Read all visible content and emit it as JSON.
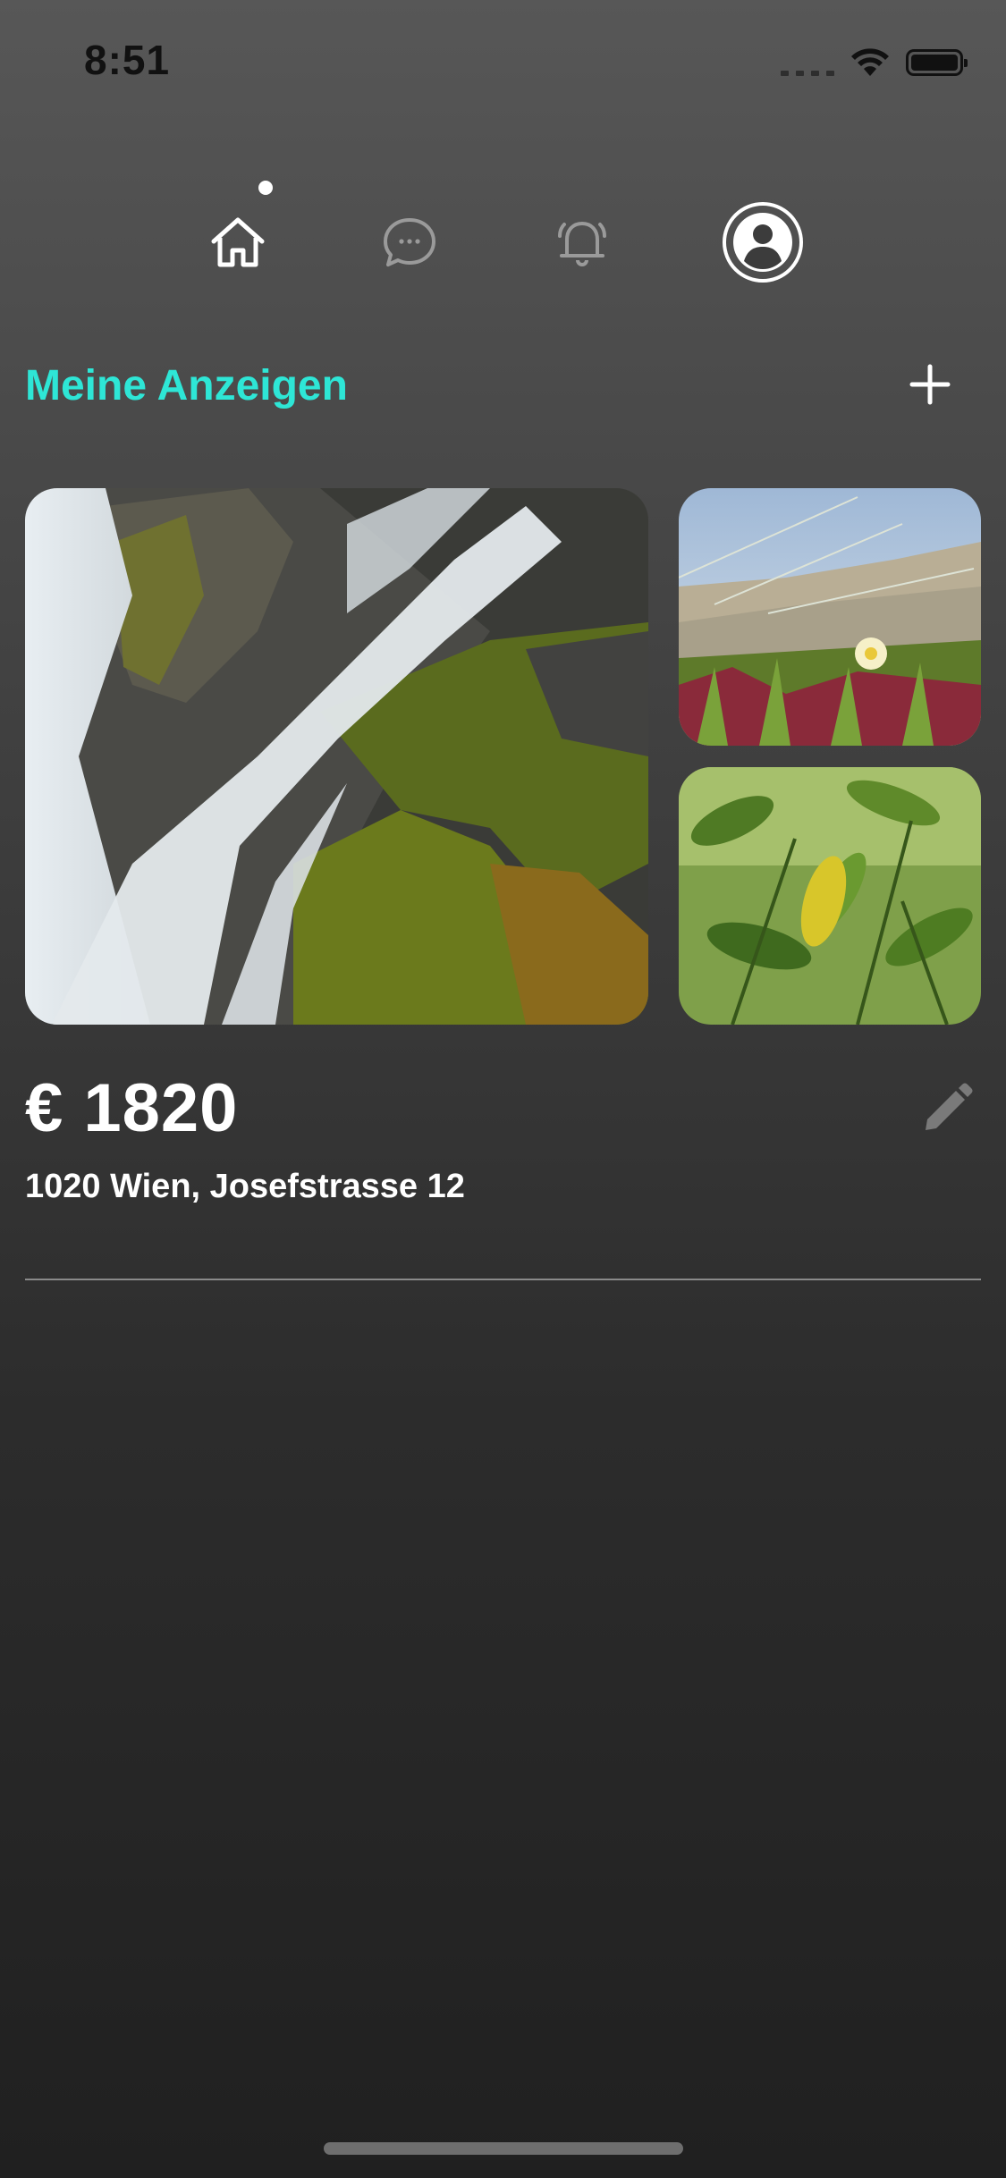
{
  "status_bar": {
    "time": "8:51",
    "icons": [
      "cellular-signal-icon",
      "wifi-icon",
      "battery-icon"
    ]
  },
  "nav": {
    "tabs": [
      {
        "icon": "home-icon",
        "active": true,
        "has_indicator": true
      },
      {
        "icon": "chat-icon",
        "active": false
      },
      {
        "icon": "bell-icon",
        "active": false
      },
      {
        "icon": "profile-icon",
        "active": true
      }
    ]
  },
  "section": {
    "title": "Meine Anzeigen",
    "add_icon": "plus-icon"
  },
  "listing": {
    "price": "€ 1820",
    "address": "1020 Wien, Josefstrasse 12",
    "edit_icon": "pencil-icon",
    "photos": [
      {
        "subject": "waterfall over mossy rocks"
      },
      {
        "subject": "dune grass with yellow flower"
      },
      {
        "subject": "green leaves with yellow leaf"
      }
    ]
  },
  "colors": {
    "accent": "#2ee6d6",
    "text": "#ffffff",
    "background_top": "#575757",
    "background_bottom": "#202020",
    "divider": "#8a8a8a"
  }
}
